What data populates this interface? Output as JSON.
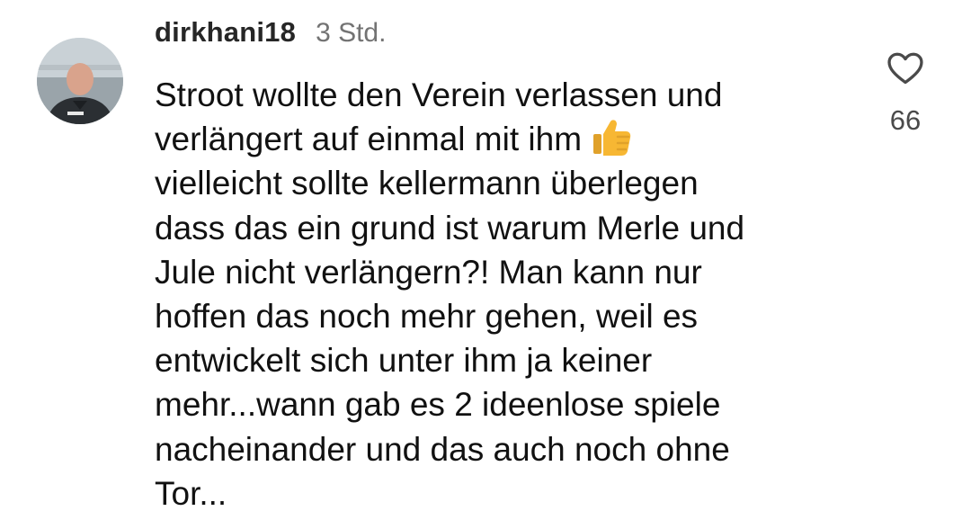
{
  "comment": {
    "username": "dirkhani18",
    "timestamp": "3 Std.",
    "lines": [
      "Stroot wollte den Verein verlassen und",
      "verlängert auf einmal mit ihm",
      "vielleicht sollte kellermann überlegen",
      "dass das ein grund ist warum Merle und",
      "Jule nicht verlängern?! Man kann nur",
      "hoffen das noch mehr gehen, weil es",
      "entwickelt sich unter ihm ja keiner",
      "mehr...wann gab es 2 ideenlose spiele",
      "nacheinander und das auch noch ohne",
      "Tor..."
    ],
    "inline_emoji": "thumbs-up-icon",
    "like_icon": "heart-outline-icon",
    "like_count": "66"
  },
  "colors": {
    "text": "#111111",
    "username": "#262626",
    "timestamp": "#737373",
    "like_count": "#4a4a4a",
    "emoji": "#f7b733"
  }
}
